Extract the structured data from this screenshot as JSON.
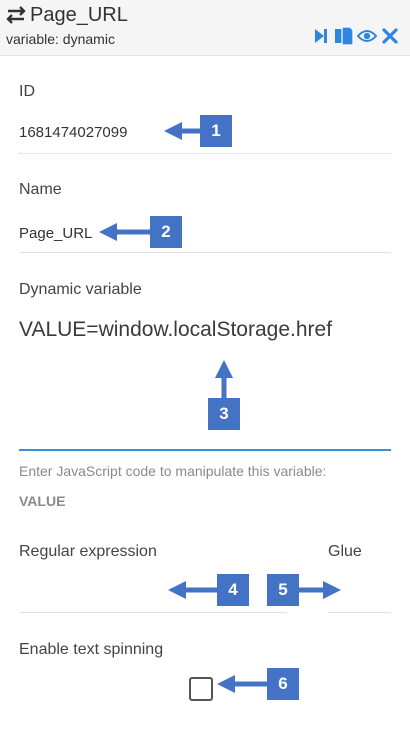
{
  "header": {
    "title": "Page_URL",
    "subtitle": "variable:  dynamic",
    "icons": [
      "swap-icon",
      "step-forward-icon",
      "copy-icon",
      "eye-icon",
      "close-icon"
    ],
    "accent_color": "#2e86de"
  },
  "fields": {
    "id": {
      "label": "ID",
      "value": "1681474027099"
    },
    "name": {
      "label": "Name",
      "value": "Page_URL"
    },
    "dynamic": {
      "label": "Dynamic variable",
      "value": "VALUE=window.localStorage.href",
      "help": "Enter JavaScript code to manipulate this variable:",
      "help_keyword": "VALUE"
    },
    "regex": {
      "label": "Regular expression",
      "value": ""
    },
    "glue": {
      "label": "Glue",
      "value": ""
    },
    "spinning": {
      "label": "Enable text spinning",
      "checked": false
    }
  },
  "annotations": {
    "color": "#4472c4",
    "badges": [
      "1",
      "2",
      "3",
      "4",
      "5",
      "6"
    ]
  }
}
